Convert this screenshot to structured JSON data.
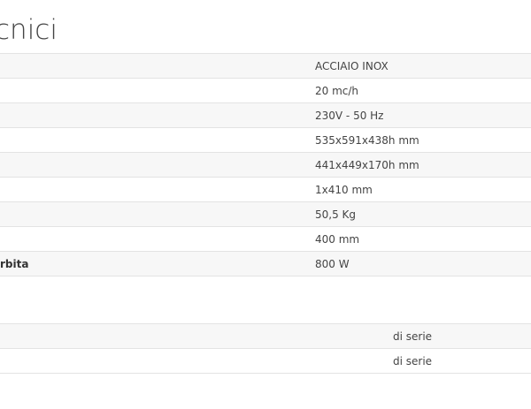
{
  "section": {
    "title": "cnici"
  },
  "specs": {
    "rows": [
      {
        "label": "",
        "value": "ACCIAIO INOX"
      },
      {
        "label": "",
        "value": "20 mc/h"
      },
      {
        "label": "",
        "value": "230V - 50 Hz"
      },
      {
        "label": "",
        "value": "535x591x438h mm"
      },
      {
        "label": "",
        "value": "441x449x170h mm"
      },
      {
        "label": "",
        "value": "1x410 mm"
      },
      {
        "label": "",
        "value": "50,5 Kg"
      },
      {
        "label": "",
        "value": "400 mm"
      },
      {
        "label": "rbita",
        "value": "800 W"
      }
    ]
  },
  "extras": {
    "rows": [
      {
        "label": "",
        "value": "di serie"
      },
      {
        "label": "",
        "value": "di serie"
      }
    ]
  }
}
